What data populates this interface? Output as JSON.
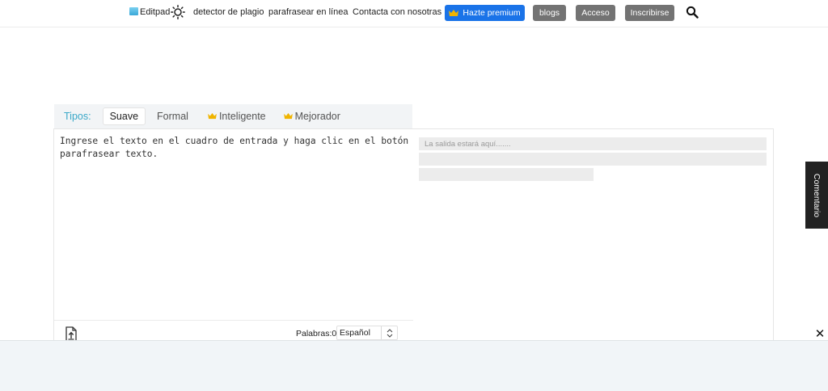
{
  "nav": {
    "logo": "Editpad",
    "links": [
      "detector de plagio",
      "parafrasear en línea",
      "Contacta con nosotras"
    ],
    "premium_label": "Hazte premium",
    "blogs_label": "blogs",
    "login_label": "Acceso",
    "signup_label": "Inscribirse"
  },
  "types": {
    "label": "Tipos:",
    "tabs": [
      "Suave",
      "Formal",
      "Inteligente",
      "Mejorador"
    ],
    "active": "Suave"
  },
  "editor": {
    "input_text": "Ingrese el texto en el cuadro de entrada y haga clic en el botón parafrasear texto.",
    "words_label": "Palabras:",
    "words_count": "0",
    "language": "Español",
    "output_placeholder": "La salida estará aquí......."
  },
  "side_tab": "Comentario",
  "colors": {
    "premium": "#1a73e8",
    "gray_button": "#737373",
    "types_label": "#3aa8c8",
    "crown": "#f0b400"
  }
}
